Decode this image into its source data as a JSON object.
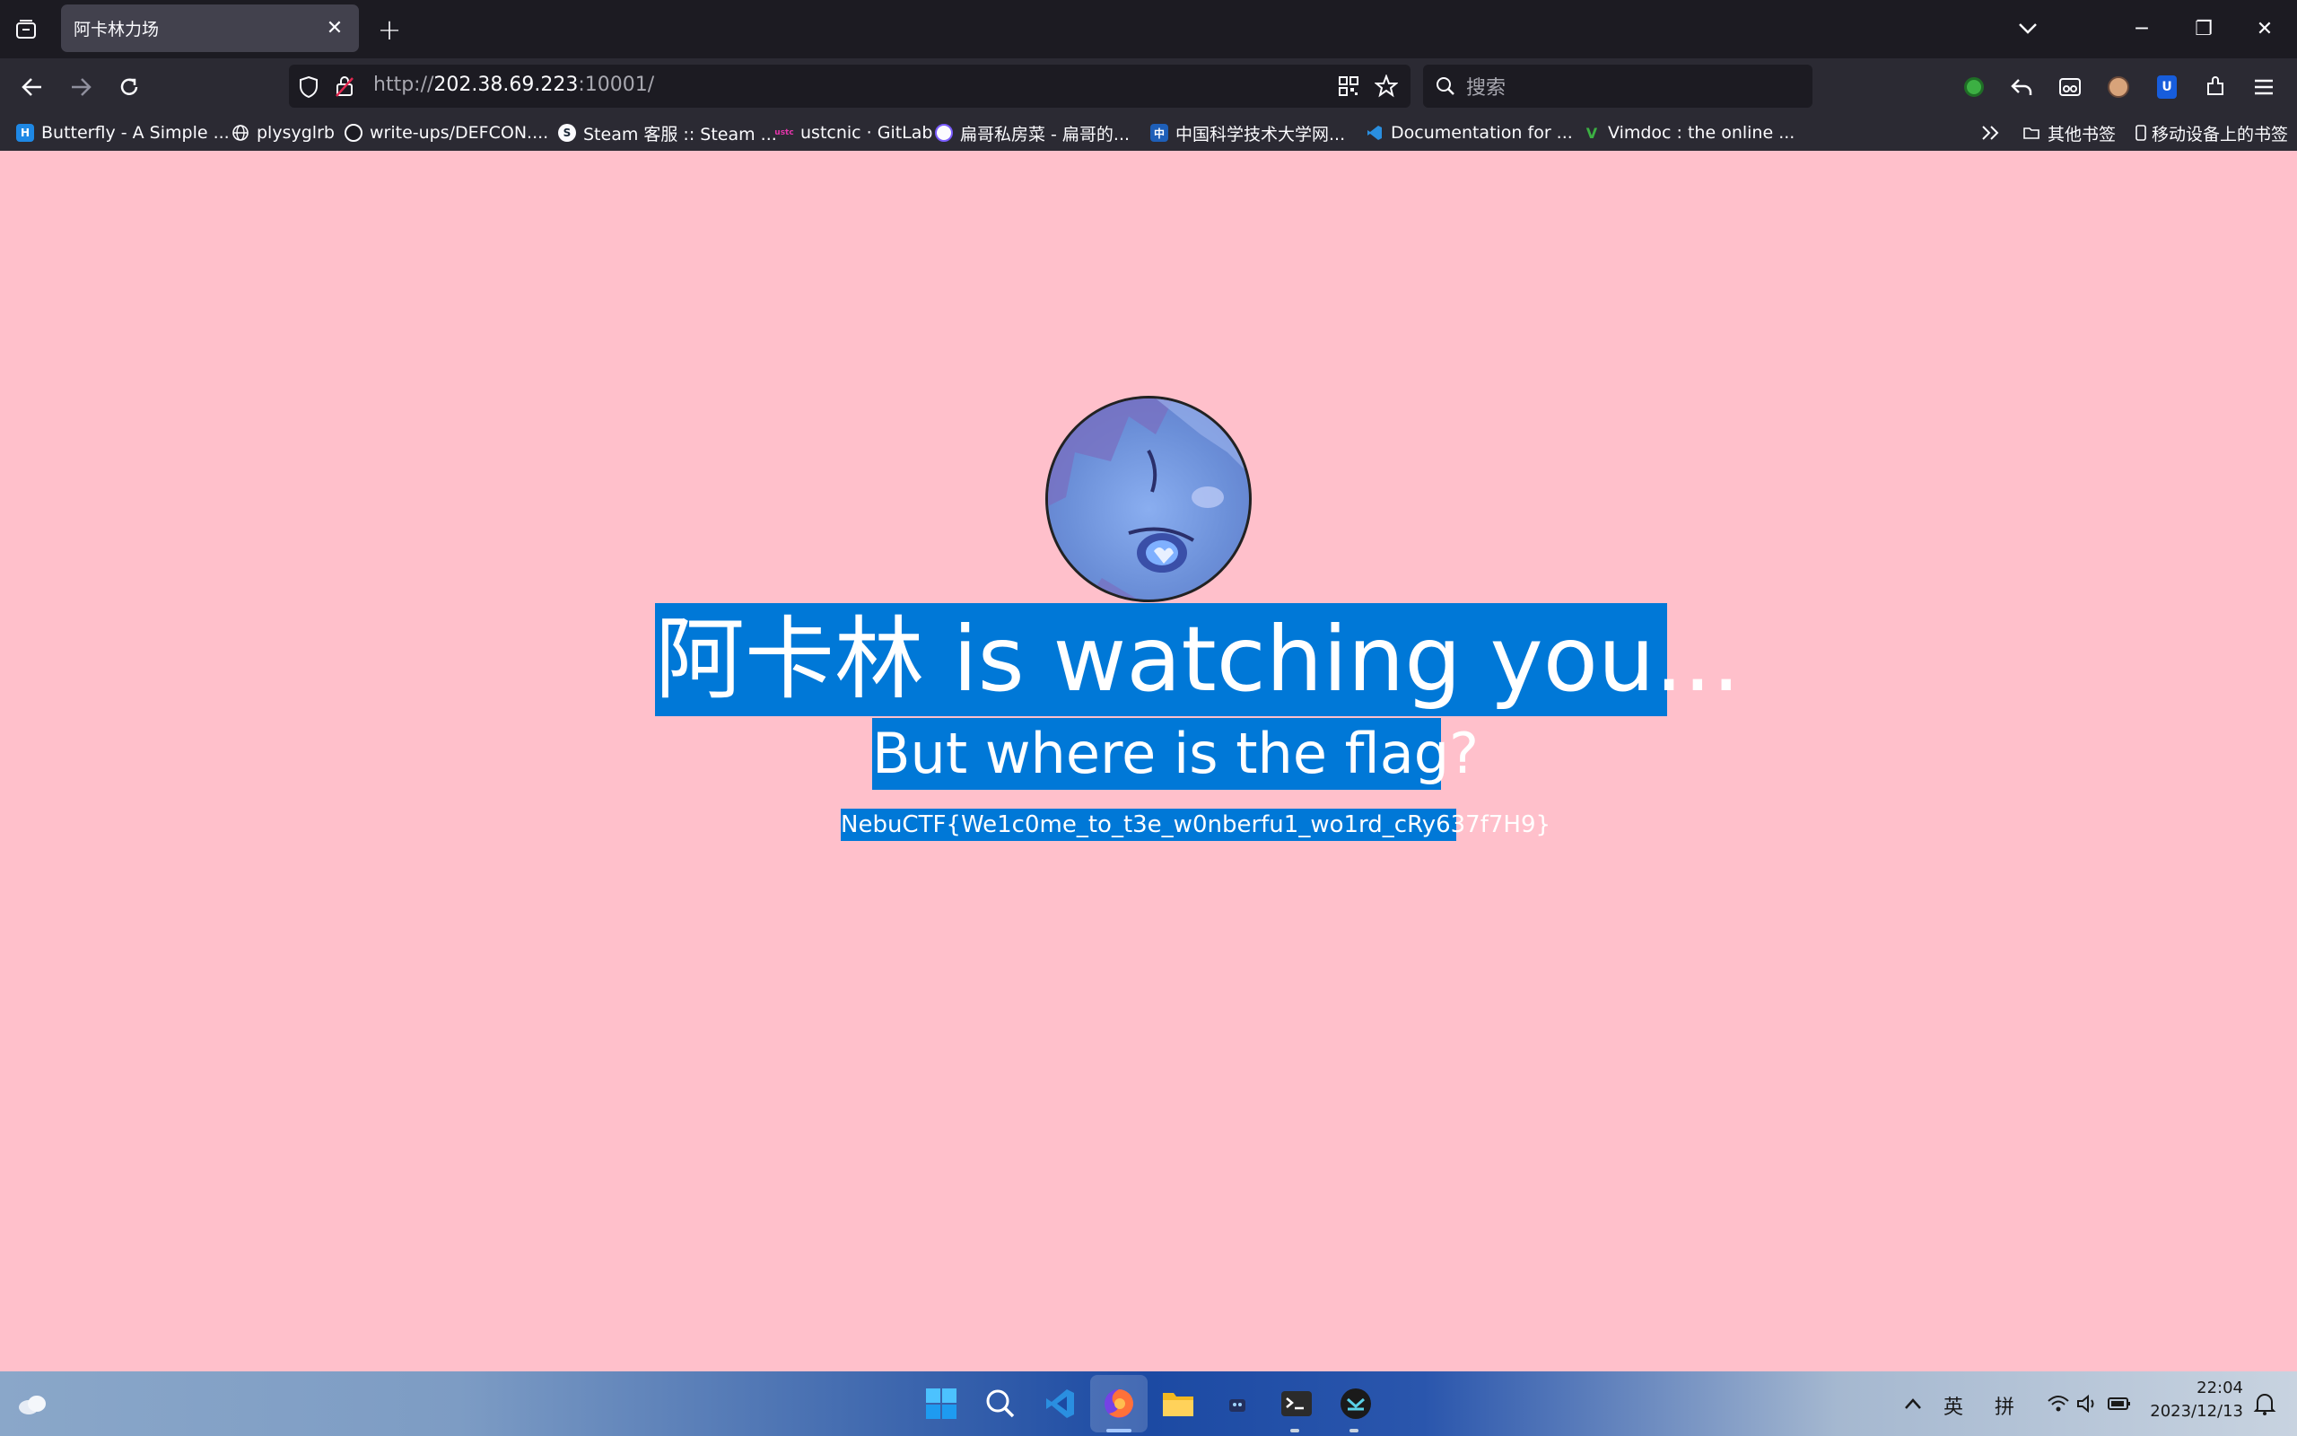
{
  "tab": {
    "title": "阿卡林力场",
    "close": "✕"
  },
  "window": {
    "minimize": "─",
    "restore": "❐",
    "close": "✕"
  },
  "urlbar": {
    "scheme": "http://",
    "host": "202.38.69.223",
    "port": ":10001/"
  },
  "searchbar": {
    "placeholder": "搜索"
  },
  "bookmarks": [
    {
      "label": "Butterfly - A Simple ...",
      "icon": "butterfly-icon"
    },
    {
      "label": "plysyglrb",
      "icon": "globe-icon"
    },
    {
      "label": "write-ups/DEFCON....",
      "icon": "github-icon"
    },
    {
      "label": "Steam 客服 :: Steam ...",
      "icon": "steam-icon"
    },
    {
      "label": "ustcnic · GitLab",
      "icon": "gitlab-icon"
    },
    {
      "label": "扁哥私房菜 - 扁哥的...",
      "icon": "blog-icon"
    },
    {
      "label": "中国科学技术大学网...",
      "icon": "ustc-icon"
    },
    {
      "label": "Documentation for ...",
      "icon": "vscode-icon"
    },
    {
      "label": "Vimdoc : the online ...",
      "icon": "vim-icon"
    }
  ],
  "bookmarks_right": {
    "other": "其他书签",
    "mobile": "移动设备上的书签"
  },
  "content": {
    "heading": "阿卡林 is watching you...",
    "subheading": "But where is the flag?",
    "flag": "NebuCTF{We1c0me_to_t3e_w0nberfu1_wo1rd_cRy637f7H9}"
  },
  "taskbar": {
    "ime_lang": "英",
    "ime_mode": "拼",
    "time": "22:04",
    "date": "2023/12/13"
  },
  "colors": {
    "page_bg": "#ffc0cb",
    "selection": "#0078d7",
    "chrome_dark": "#1c1b22",
    "chrome_toolbar": "#2b2a33"
  }
}
